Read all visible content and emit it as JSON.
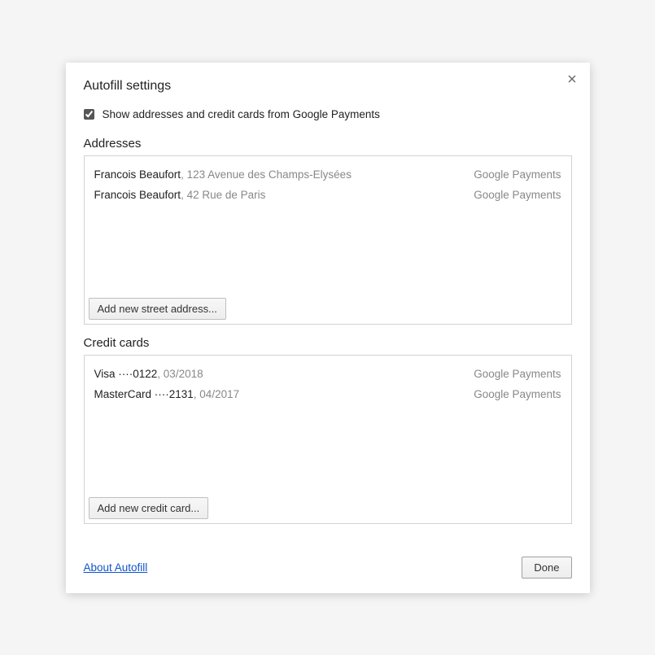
{
  "dialog": {
    "title": "Autofill settings",
    "checkbox_label": "Show addresses and credit cards from Google Payments",
    "checkbox_checked": true
  },
  "addresses": {
    "heading": "Addresses",
    "items": [
      {
        "name": "Francois Beaufort",
        "detail": ", 123 Avenue des Champs-Elysées",
        "source": "Google Payments"
      },
      {
        "name": "Francois Beaufort",
        "detail": ", 42 Rue de Paris",
        "source": "Google Payments"
      }
    ],
    "add_button": "Add new street address..."
  },
  "credit_cards": {
    "heading": "Credit cards",
    "items": [
      {
        "name": "Visa ····0122",
        "detail": ", 03/2018",
        "source": "Google Payments"
      },
      {
        "name": "MasterCard ····2131",
        "detail": ", 04/2017",
        "source": "Google Payments"
      }
    ],
    "add_button": "Add new credit card..."
  },
  "footer": {
    "about_link": "About Autofill",
    "done_button": "Done"
  }
}
